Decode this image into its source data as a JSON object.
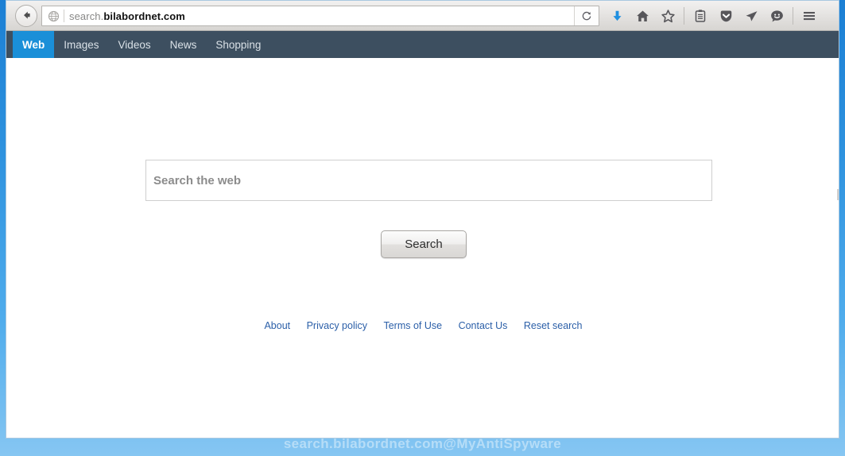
{
  "browser": {
    "back_label": "Back",
    "identity_icon": "globe-icon",
    "url_prefix": "search.",
    "url_domain": "bilabordnet.com",
    "url_full": "search.bilabordnet.com",
    "reload_label": "Reload",
    "toolbar_icons": [
      {
        "name": "download-icon",
        "glyph": "⬇",
        "color": "#1f8fe0",
        "label": "Downloads"
      },
      {
        "name": "home-icon",
        "glyph": "⌂",
        "color": "#57565a",
        "label": "Home"
      },
      {
        "name": "bookmark-star-icon",
        "glyph": "☆",
        "color": "#57565a",
        "label": "Bookmark this page"
      },
      {
        "name": "reader-list-icon",
        "glyph": "Ὄb",
        "color": "#57565a",
        "label": "Reading list"
      },
      {
        "name": "pocket-icon",
        "glyph": "▼",
        "color": "#57565a",
        "label": "Save to Pocket"
      },
      {
        "name": "send-icon",
        "glyph": "➤",
        "color": "#57565a",
        "label": "Send tab"
      },
      {
        "name": "feedback-smiley-icon",
        "glyph": "☺",
        "color": "#57565a",
        "label": "Feedback"
      },
      {
        "name": "hamburger-menu-icon",
        "glyph": "☰",
        "color": "#57565a",
        "label": "Open menu"
      }
    ]
  },
  "site_nav": {
    "items": [
      {
        "label": "Web",
        "active": true
      },
      {
        "label": "Images",
        "active": false
      },
      {
        "label": "Videos",
        "active": false
      },
      {
        "label": "News",
        "active": false
      },
      {
        "label": "Shopping",
        "active": false
      }
    ],
    "bar_color": "#3d4f60",
    "active_color": "#1a8fd8"
  },
  "search": {
    "value": "",
    "placeholder": "Search the web",
    "button_label": "Search"
  },
  "footer": {
    "links": [
      {
        "label": "About"
      },
      {
        "label": "Privacy policy"
      },
      {
        "label": "Terms of Use"
      },
      {
        "label": "Contact Us"
      },
      {
        "label": "Reset search"
      }
    ],
    "link_color": "#2b5fa8"
  },
  "watermark": {
    "text": "search.bilabordnet.com@MyAntiSpyware"
  }
}
